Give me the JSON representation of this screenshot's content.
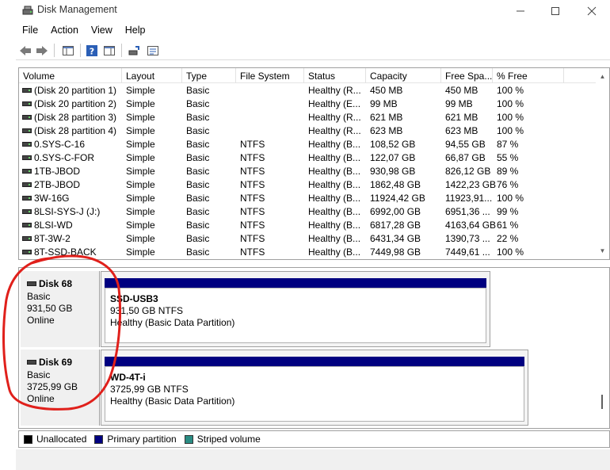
{
  "window": {
    "title": "Disk Management"
  },
  "menu": [
    "File",
    "Action",
    "View",
    "Help"
  ],
  "columns": [
    "Volume",
    "Layout",
    "Type",
    "File System",
    "Status",
    "Capacity",
    "Free Spa...",
    "% Free"
  ],
  "volumes": [
    {
      "volume": "(Disk 20 partition 1)",
      "layout": "Simple",
      "type": "Basic",
      "fs": "",
      "status": "Healthy (R...",
      "capacity": "450 MB",
      "free": "450 MB",
      "pct": "100 %"
    },
    {
      "volume": "(Disk 20 partition 2)",
      "layout": "Simple",
      "type": "Basic",
      "fs": "",
      "status": "Healthy (E...",
      "capacity": "99 MB",
      "free": "99 MB",
      "pct": "100 %"
    },
    {
      "volume": "(Disk 28 partition 3)",
      "layout": "Simple",
      "type": "Basic",
      "fs": "",
      "status": "Healthy (R...",
      "capacity": "621 MB",
      "free": "621 MB",
      "pct": "100 %"
    },
    {
      "volume": "(Disk 28 partition 4)",
      "layout": "Simple",
      "type": "Basic",
      "fs": "",
      "status": "Healthy (R...",
      "capacity": "623 MB",
      "free": "623 MB",
      "pct": "100 %"
    },
    {
      "volume": "0.SYS-C-16",
      "layout": "Simple",
      "type": "Basic",
      "fs": "NTFS",
      "status": "Healthy (B...",
      "capacity": "108,52 GB",
      "free": "94,55 GB",
      "pct": "87 %"
    },
    {
      "volume": "0.SYS-C-FOR",
      "layout": "Simple",
      "type": "Basic",
      "fs": "NTFS",
      "status": "Healthy (B...",
      "capacity": "122,07 GB",
      "free": "66,87 GB",
      "pct": "55 %"
    },
    {
      "volume": "1TB-JBOD",
      "layout": "Simple",
      "type": "Basic",
      "fs": "NTFS",
      "status": "Healthy (B...",
      "capacity": "930,98 GB",
      "free": "826,12 GB",
      "pct": "89 %"
    },
    {
      "volume": "2TB-JBOD",
      "layout": "Simple",
      "type": "Basic",
      "fs": "NTFS",
      "status": "Healthy (B...",
      "capacity": "1862,48 GB",
      "free": "1422,23 GB",
      "pct": "76 %"
    },
    {
      "volume": "3W-16G",
      "layout": "Simple",
      "type": "Basic",
      "fs": "NTFS",
      "status": "Healthy (B...",
      "capacity": "11924,42 GB",
      "free": "11923,91...",
      "pct": "100 %"
    },
    {
      "volume": "8LSI-SYS-J (J:)",
      "layout": "Simple",
      "type": "Basic",
      "fs": "NTFS",
      "status": "Healthy (B...",
      "capacity": "6992,00 GB",
      "free": "6951,36 ...",
      "pct": "99 %"
    },
    {
      "volume": "8LSI-WD",
      "layout": "Simple",
      "type": "Basic",
      "fs": "NTFS",
      "status": "Healthy (B...",
      "capacity": "6817,28 GB",
      "free": "4163,64 GB",
      "pct": "61 %"
    },
    {
      "volume": "8T-3W-2",
      "layout": "Simple",
      "type": "Basic",
      "fs": "NTFS",
      "status": "Healthy (B...",
      "capacity": "6431,34 GB",
      "free": "1390,73 ...",
      "pct": "22 %"
    },
    {
      "volume": "8T-SSD-BACK",
      "layout": "Simple",
      "type": "Basic",
      "fs": "NTFS",
      "status": "Healthy (B...",
      "capacity": "7449,98 GB",
      "free": "7449,61 ...",
      "pct": "100 %"
    }
  ],
  "disks": [
    {
      "name": "Disk 68",
      "type": "Basic",
      "size": "931,50 GB",
      "state": "Online",
      "partition": {
        "name": "SSD-USB3",
        "size_fs": "931,50 GB NTFS",
        "status": "Healthy (Basic Data Partition)"
      }
    },
    {
      "name": "Disk 69",
      "type": "Basic",
      "size": "3725,99 GB",
      "state": "Online",
      "partition": {
        "name": "WD-4T-i",
        "size_fs": "3725,99 GB NTFS",
        "status": "Healthy (Basic Data Partition)"
      }
    }
  ],
  "legend": [
    {
      "label": "Unallocated",
      "color": "#000000"
    },
    {
      "label": "Primary partition",
      "color": "#000080"
    },
    {
      "label": "Striped volume",
      "color": "#2a8c83"
    }
  ],
  "colors": {
    "primary_partition": "#000080",
    "annotation": "#e0201b"
  }
}
